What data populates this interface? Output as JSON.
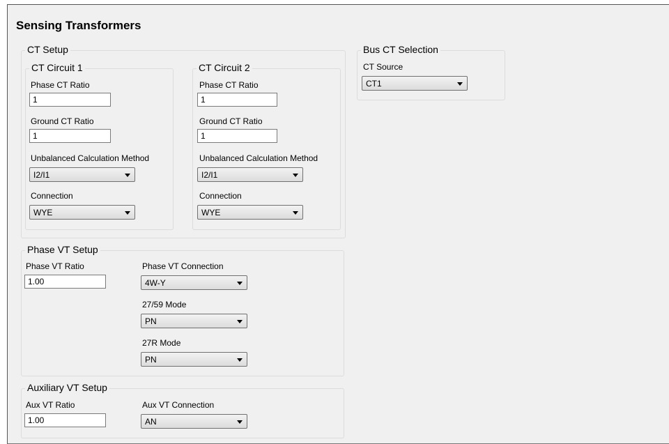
{
  "title": "Sensing Transformers",
  "ct_setup": {
    "legend": "CT Setup",
    "circuit1": {
      "legend": "CT Circuit 1",
      "phase_ct_label": "Phase CT Ratio",
      "phase_ct_value": "1",
      "ground_ct_label": "Ground CT Ratio",
      "ground_ct_value": "1",
      "unbalanced_label": "Unbalanced Calculation Method",
      "unbalanced_value": "I2/I1",
      "connection_label": "Connection",
      "connection_value": "WYE"
    },
    "circuit2": {
      "legend": "CT Circuit 2",
      "phase_ct_label": "Phase CT Ratio",
      "phase_ct_value": "1",
      "ground_ct_label": "Ground CT Ratio",
      "ground_ct_value": "1",
      "unbalanced_label": "Unbalanced Calculation Method",
      "unbalanced_value": "I2/I1",
      "connection_label": "Connection",
      "connection_value": "WYE"
    }
  },
  "bus_ct": {
    "legend": "Bus CT Selection",
    "source_label": "CT Source",
    "source_value": "CT1"
  },
  "phase_vt": {
    "legend": "Phase VT Setup",
    "ratio_label": "Phase VT Ratio",
    "ratio_value": "1.00",
    "connection_label": "Phase VT Connection",
    "connection_value": "4W-Y",
    "mode_2759_label": "27/59 Mode",
    "mode_2759_value": "PN",
    "mode_27r_label": "27R Mode",
    "mode_27r_value": "PN"
  },
  "aux_vt": {
    "legend": "Auxiliary VT Setup",
    "ratio_label": "Aux VT Ratio",
    "ratio_value": "1.00",
    "connection_label": "Aux VT Connection",
    "connection_value": "AN"
  }
}
